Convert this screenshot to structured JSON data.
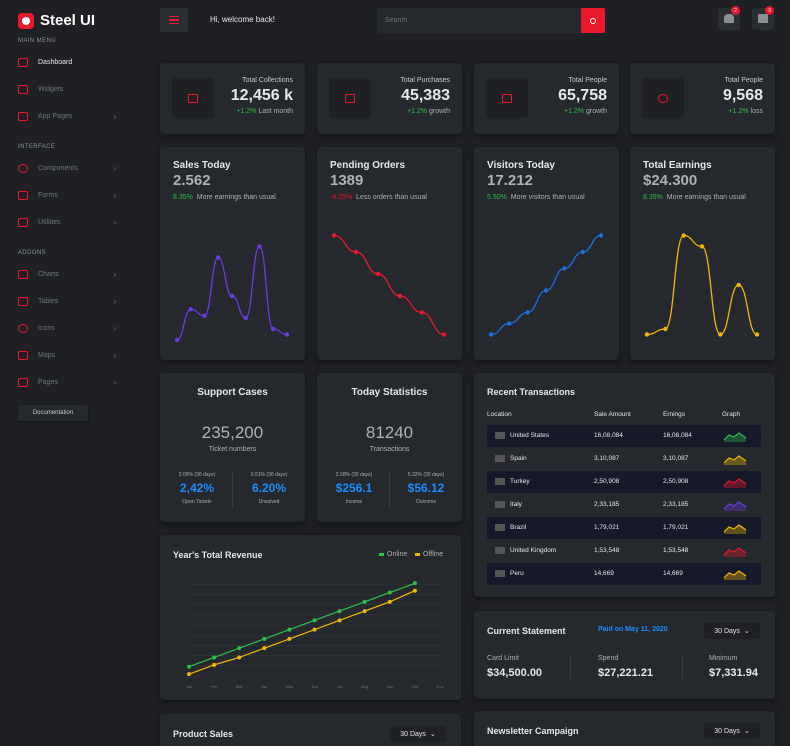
{
  "brand": {
    "name": "Steel UI",
    "accent": "#e8192c",
    "bg": "#1e2024",
    "card": "#25282d"
  },
  "sidebar": {
    "main_menu": "MAIN MENU",
    "interface": "INTERFACE",
    "addons": "ADDONS",
    "items": [
      {
        "label": "Dashboard",
        "icon": "monitor-icon",
        "active": true
      },
      {
        "label": "Widgets",
        "icon": "monitor-icon"
      },
      {
        "label": "App Pages",
        "icon": "monitor-icon",
        "chevron": true
      },
      {
        "label": "Components",
        "icon": "cog-icon",
        "chevron": true
      },
      {
        "label": "Forms",
        "icon": "megaphone-icon",
        "chevron": true
      },
      {
        "label": "Utilities",
        "icon": "grid-icon",
        "chevron": true
      },
      {
        "label": "Charts",
        "icon": "bar-chart-icon",
        "chevron": true
      },
      {
        "label": "Tables",
        "icon": "table-icon",
        "chevron": true
      },
      {
        "label": "Icons",
        "icon": "smiley-icon",
        "chevron": true
      },
      {
        "label": "Maps",
        "icon": "map-icon",
        "chevron": true
      },
      {
        "label": "Pages",
        "icon": "file-icon",
        "chevron": true
      }
    ],
    "documentation": "Documentation"
  },
  "header": {
    "welcome": "Hi, welcome back!",
    "search_placeholder": "Search",
    "notif_count": "2",
    "mail_count": "3"
  },
  "stats": [
    {
      "label": "Total Collections",
      "value": "12,456 k",
      "change": "+1.2%",
      "suffix": "Last month",
      "icon": "folder-icon"
    },
    {
      "label": "Total Purchases",
      "value": "45,383",
      "change": "+1.2%",
      "suffix": "growth",
      "icon": "clipboard-icon"
    },
    {
      "label": "Total People",
      "value": "65,758",
      "change": "+1.2%",
      "suffix": "growth",
      "icon": "document-icon"
    },
    {
      "label": "Total People",
      "value": "9,568",
      "change": "+1.2%",
      "suffix": "loss",
      "icon": "user-icon"
    }
  ],
  "mini_charts": [
    {
      "title": "Sales Today",
      "value": "2.562",
      "pct": "8.35%",
      "note": "More earnings than usual",
      "color": "#6a3be0",
      "pct_color": "#2fbf4a",
      "points": [
        0,
        28,
        22,
        75,
        40,
        20,
        85,
        10,
        5
      ]
    },
    {
      "title": "Pending Orders",
      "value": "1389",
      "pct": "-4.25%",
      "note": "Less orders than usual",
      "color": "#e8192c",
      "pct_color": "#e8192c",
      "points": [
        95,
        80,
        60,
        40,
        25,
        5
      ]
    },
    {
      "title": "Visitors Today",
      "value": "17.212",
      "pct": "5.50%",
      "note": "More visitors than usual",
      "color": "#1b6fe0",
      "pct_color": "#2fbf4a",
      "points": [
        5,
        15,
        25,
        45,
        65,
        80,
        95
      ]
    },
    {
      "title": "Total Earnings",
      "value": "$24.300",
      "pct": "8.35%",
      "note": "More earnings than usual",
      "color": "#f2b705",
      "pct_color": "#2fbf4a",
      "points": [
        5,
        10,
        95,
        85,
        5,
        50,
        5
      ]
    }
  ],
  "support": {
    "title": "Support Cases",
    "value": "235,200",
    "caption": "Ticket numbers",
    "left": {
      "period": "2.09% (30 days)",
      "value": "2,42%",
      "caption": "Open Tickets"
    },
    "right": {
      "period": "0.51% (30 days)",
      "value": "6.20%",
      "caption": "Unsolved"
    }
  },
  "today_stats": {
    "title": "Today Statistics",
    "value": "81240",
    "caption": "Transactions",
    "left": {
      "period": "2.00% (30 days)",
      "value": "$256.1",
      "caption": "Income"
    },
    "right": {
      "period": "5.32% (30 days)",
      "value": "$56.12",
      "caption": "Outcome"
    }
  },
  "transactions": {
    "title": "Recent Transactions",
    "headers": [
      "Location",
      "Sale Amount",
      "Ernings",
      "Graph"
    ],
    "rows": [
      {
        "country": "United States",
        "sale": "16,08,084",
        "earn": "16,08,084",
        "spark": "green"
      },
      {
        "country": "Spain",
        "sale": "3,10,087",
        "earn": "3,10,087",
        "spark": "yellow"
      },
      {
        "country": "Turkey",
        "sale": "2,50,908",
        "earn": "2,50,908",
        "spark": "red"
      },
      {
        "country": "Italy",
        "sale": "2,33,185",
        "earn": "2,33,185",
        "spark": "purple"
      },
      {
        "country": "Brazil",
        "sale": "1,79,021",
        "earn": "1,79,021",
        "spark": "yellow"
      },
      {
        "country": "United Kingdom",
        "sale": "1,53,548",
        "earn": "1,53,548",
        "spark": "red"
      },
      {
        "country": "Peru",
        "sale": "14,669",
        "earn": "14,669",
        "spark": "yellow"
      }
    ],
    "colors": {
      "green": "#2fbf4a",
      "yellow": "#f2b705",
      "red": "#e8192c",
      "purple": "#6a3be0"
    }
  },
  "revenue": {
    "title": "Year's Total Revenue",
    "legend": [
      "Online",
      "Offline"
    ],
    "chart_data": {
      "type": "line",
      "x": [
        "Jan",
        "Feb",
        "Mar",
        "Apr",
        "May",
        "Jun",
        "Jul",
        "Aug",
        "Sep",
        "Oct",
        "Nov"
      ],
      "series": [
        {
          "name": "Online",
          "color": "#2fbf4a",
          "values": [
            10,
            20,
            30,
            40,
            50,
            60,
            70,
            80,
            90,
            100
          ]
        },
        {
          "name": "Offline",
          "color": "#f2b705",
          "values": [
            2,
            12,
            20,
            30,
            40,
            50,
            60,
            70,
            80,
            92
          ]
        }
      ],
      "ylim": [
        0,
        110
      ]
    }
  },
  "statement": {
    "title": "Current Statement",
    "paid": "Paid on May 11, 2020",
    "range": "30 Days",
    "card_limit_lbl": "Card Limit",
    "card_limit": "$34,500.00",
    "spend_lbl": "Spend",
    "spend": "$27,221.21",
    "min_lbl": "Minimum",
    "min": "$7,331.94"
  },
  "product_sales": {
    "title": "Product Sales",
    "range": "30 Days"
  },
  "newsletter": {
    "title": "Newsletter Campaign",
    "range": "30 Days"
  }
}
